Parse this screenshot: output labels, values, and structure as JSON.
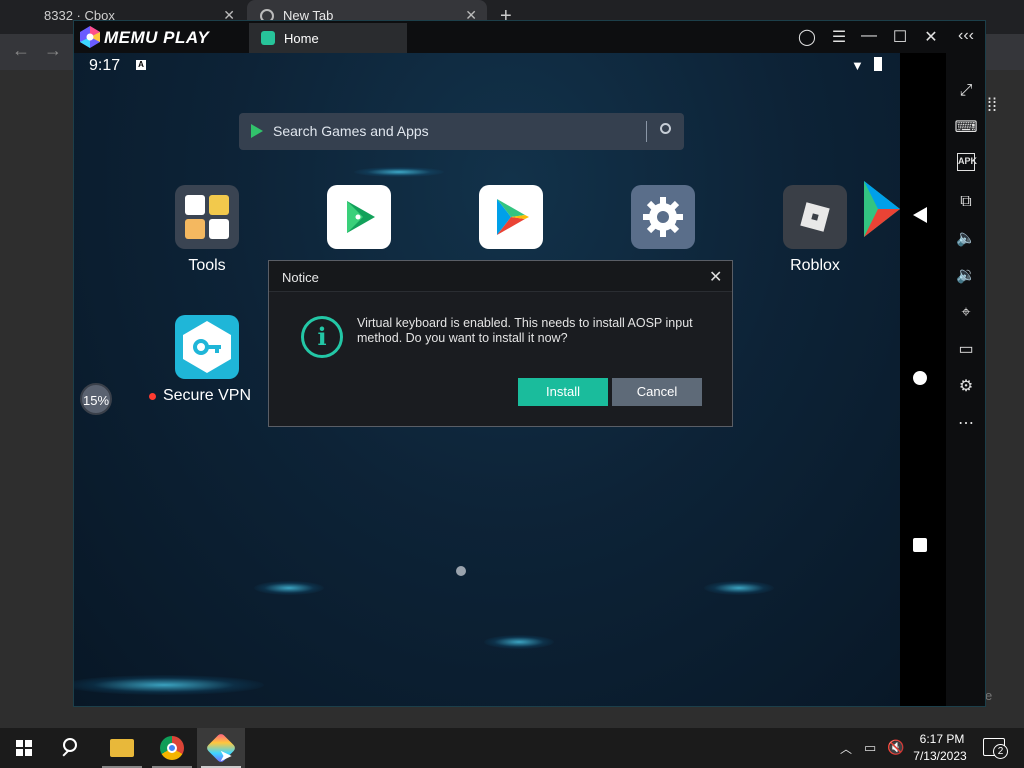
{
  "browser": {
    "tabs": [
      {
        "label": "8332 · Cbox"
      },
      {
        "label": "New Tab"
      }
    ],
    "new_tab": "+",
    "close": "✕"
  },
  "memu": {
    "brand": "MEMU PLAY",
    "tab_label": "Home",
    "controls": {
      "account": "◯",
      "menu": "☰",
      "minimize": "—",
      "maximize": "☐",
      "close": "✕",
      "collapse": "‹‹‹"
    }
  },
  "android": {
    "status": {
      "time": "9:17",
      "indicator": "A"
    },
    "search": {
      "placeholder": "Search Games and Apps"
    },
    "apps": [
      {
        "label": "Tools",
        "icon": "tools-folder-icon"
      },
      {
        "label": "",
        "icon": "play-games-icon"
      },
      {
        "label": "",
        "icon": "play-store-icon"
      },
      {
        "label": "",
        "icon": "settings-icon"
      },
      {
        "label": "Roblox",
        "icon": "roblox-icon"
      },
      {
        "label": "Secure VPN",
        "icon": "vpn-key-icon"
      }
    ],
    "clean_badge": "15%"
  },
  "notice": {
    "title": "Notice",
    "message": "Virtual keyboard is enabled. This needs to install AOSP input method. Do you want to install it now?",
    "install_label": "Install",
    "cancel_label": "Cancel",
    "accent": "#1abc9c"
  },
  "sidebar": {
    "items": [
      "fullscreen-icon",
      "keyboard-icon",
      "apk-icon",
      "multi-instance-icon",
      "volume-up-icon",
      "volume-down-icon",
      "location-icon",
      "folder-icon",
      "settings-icon",
      "more-icon"
    ],
    "apk_text": "APK"
  },
  "taskbar": {
    "time": "6:17 PM",
    "date": "7/13/2023",
    "notifications": "2"
  }
}
